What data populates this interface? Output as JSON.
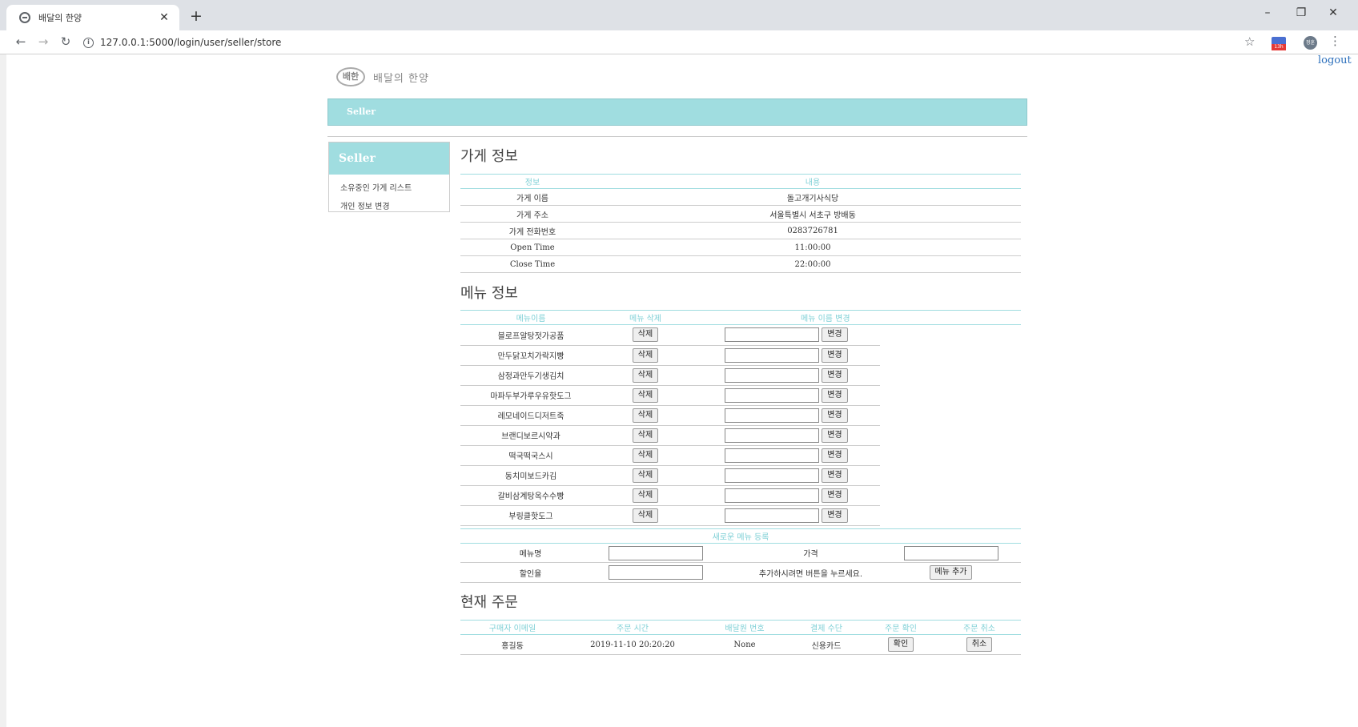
{
  "browser": {
    "tab_title": "배달의 한양",
    "tab_close": "✕",
    "new_tab": "+",
    "url": "127.0.0.1:5000/login/user/seller/store",
    "minimize": "–",
    "restore": "❐",
    "close": "✕",
    "ext_badge": "13h",
    "profile": "정훈"
  },
  "header": {
    "logout": "logout",
    "logo_badge": "배한",
    "logo_text": "배달의 한양",
    "topbar_label": "Seller"
  },
  "sidebar": {
    "title": "Seller",
    "items": [
      "소유중인 가게 리스트",
      "개인 정보 변경"
    ]
  },
  "store": {
    "title": "가게 정보",
    "headers": [
      "정보",
      "내용"
    ],
    "rows": [
      {
        "label": "가게 이름",
        "value": "돌고개기사식당"
      },
      {
        "label": "가게 주소",
        "value": "서울특별시 서초구 방배동"
      },
      {
        "label": "가게 전화번호",
        "value": "0283726781"
      },
      {
        "label": "Open Time",
        "value": "11:00:00"
      },
      {
        "label": "Close Time",
        "value": "22:00:00"
      }
    ]
  },
  "menu": {
    "title": "메뉴 정보",
    "headers": [
      "메뉴이름",
      "메뉴 삭제",
      "메뉴 이름 변경"
    ],
    "delete_label": "삭제",
    "change_label": "변경",
    "items": [
      "블로프알탕젓가공품",
      "만두닭꼬치가락지빵",
      "삼정과만두기생김치",
      "마파두부가루우유핫도그",
      "레모네이드디저트죽",
      "브랜디보르시약과",
      "떡국떡국스시",
      "동치미보드카김",
      "갈비삼계탕옥수수빵",
      "부링클핫도그"
    ],
    "new_title": "새로운 메뉴 등록",
    "new_name_label": "메뉴명",
    "new_price_label": "가격",
    "new_discount_label": "할인율",
    "new_hint": "추가하시려면 버튼을 누르세요.",
    "add_button": "메뉴 추가"
  },
  "orders": {
    "title": "현재 주문",
    "headers": [
      "구매자 이메일",
      "주문 시간",
      "배달원 번호",
      "결제 수단",
      "주문 확인",
      "주문 취소"
    ],
    "rows": [
      {
        "buyer": "홍길동",
        "time": "2019-11-10 20:20:20",
        "courier": "None",
        "payment": "신용카드",
        "confirm": "확인",
        "cancel": "취소"
      }
    ]
  }
}
